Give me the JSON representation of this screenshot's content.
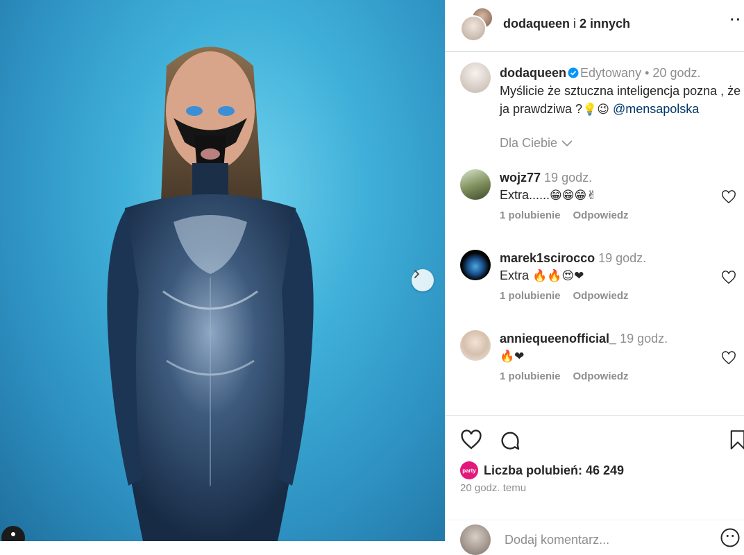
{
  "header": {
    "username": "dodaqueen",
    "connector": " i ",
    "others": "2 innych",
    "more": "··"
  },
  "caption": {
    "username": "dodaqueen",
    "edited": "Edytowany",
    "separator": "•",
    "time": "20 godz.",
    "text": "Myślicie że sztuczna inteligencja pozna , że ja prawdziwa ?",
    "emoji": "💡😉",
    "mention": "@mensapolska"
  },
  "filter": {
    "label": "Dla Ciebie"
  },
  "comments": [
    {
      "username": "wojz77",
      "time": "19 godz.",
      "text": "Extra......",
      "emoji": "😁😁😁✌",
      "likes": "1 polubienie",
      "reply": "Odpowiedz"
    },
    {
      "username": "marek1scirocco",
      "time": "19 godz.",
      "text": "Extra ",
      "emoji": "🔥🔥😍❤",
      "likes": "1 polubienie",
      "reply": "Odpowiedz"
    },
    {
      "username": "anniequeenofficial_",
      "time": "19 godz.",
      "text": "",
      "emoji": "🔥❤",
      "likes": "1 polubienie",
      "reply": "Odpowiedz"
    }
  ],
  "footer": {
    "party_badge": "party",
    "likes_label": "Liczba polubień: 46 249",
    "time_ago": "20 godz. temu",
    "add_comment_placeholder": "Dodaj komentarz..."
  },
  "colors": {
    "verified": "#0095f6",
    "mention": "#00376b",
    "muted": "#8e8e8e",
    "party": "#e2197b"
  },
  "icons": [
    "chevron-right-icon",
    "heart-icon",
    "comment-icon",
    "bookmark-icon",
    "verified-icon",
    "chevron-down-icon",
    "emoji-icon"
  ]
}
